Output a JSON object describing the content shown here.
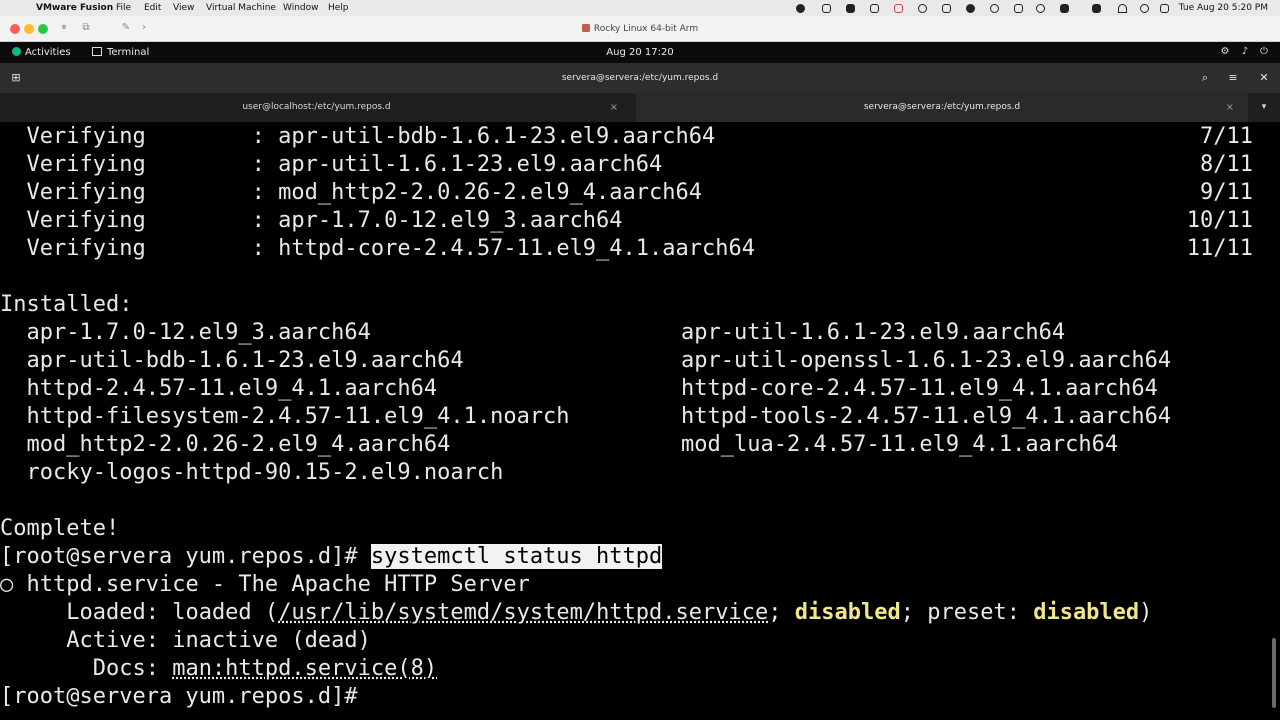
{
  "mac_menubar": {
    "app_name": "VMware Fusion",
    "menus": [
      "File",
      "Edit",
      "View",
      "Virtual Machine",
      "Window",
      "Help"
    ],
    "clock": "Tue Aug 20  5:20 PM"
  },
  "vm_window": {
    "title": "Rocky Linux 64-bit Arm"
  },
  "gnome_bar": {
    "activities": "Activities",
    "app": "Terminal",
    "datetime": "Aug 20  17:20"
  },
  "terminal": {
    "header_title": "servera@servera:/etc/yum.repos.d",
    "tabs": [
      {
        "label": "user@localhost:/etc/yum.repos.d"
      },
      {
        "label": "servera@servera:/etc/yum.repos.d"
      }
    ],
    "verify_rows": [
      {
        "action": "Verifying",
        "pkg": "apr-util-bdb-1.6.1-23.el9.aarch64",
        "count": "7/11"
      },
      {
        "action": "Verifying",
        "pkg": "apr-util-1.6.1-23.el9.aarch64",
        "count": "8/11"
      },
      {
        "action": "Verifying",
        "pkg": "mod_http2-2.0.26-2.el9_4.aarch64",
        "count": "9/11"
      },
      {
        "action": "Verifying",
        "pkg": "apr-1.7.0-12.el9_3.aarch64",
        "count": "10/11"
      },
      {
        "action": "Verifying",
        "pkg": "httpd-core-2.4.57-11.el9_4.1.aarch64",
        "count": "11/11"
      }
    ],
    "installed_heading": "Installed:",
    "installed_left": [
      "apr-1.7.0-12.el9_3.aarch64",
      "apr-util-bdb-1.6.1-23.el9.aarch64",
      "httpd-2.4.57-11.el9_4.1.aarch64",
      "httpd-filesystem-2.4.57-11.el9_4.1.noarch",
      "mod_http2-2.0.26-2.el9_4.aarch64",
      "rocky-logos-httpd-90.15-2.el9.noarch"
    ],
    "installed_right": [
      "apr-util-1.6.1-23.el9.aarch64",
      "apr-util-openssl-1.6.1-23.el9.aarch64",
      "httpd-core-2.4.57-11.el9_4.1.aarch64",
      "httpd-tools-2.4.57-11.el9_4.1.aarch64",
      "mod_lua-2.4.57-11.el9_4.1.aarch64"
    ],
    "complete": "Complete!",
    "prompt": "[root@servera yum.repos.d]#",
    "command": "systemctl status httpd",
    "status": {
      "bullet": "○",
      "service_line": "httpd.service - The Apache HTTP Server",
      "loaded_label": "Loaded:",
      "loaded_value": "loaded",
      "loaded_path": "/usr/lib/systemd/system/httpd.service",
      "loaded_state": "disabled",
      "preset_label": "preset:",
      "preset_state": "disabled",
      "active_label": "Active:",
      "active_value": "inactive (dead)",
      "docs_label": "Docs:",
      "docs_value": "man:httpd.service(8)"
    }
  }
}
